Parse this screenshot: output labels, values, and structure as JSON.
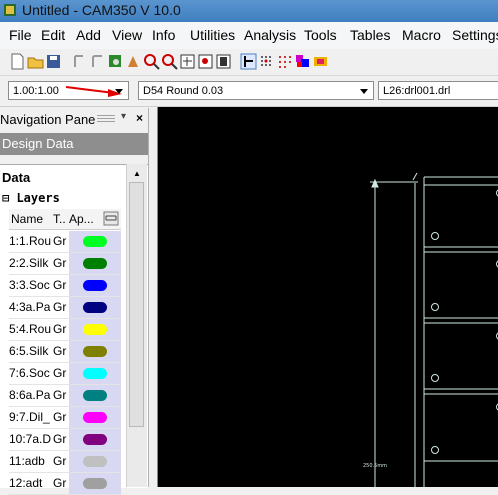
{
  "window": {
    "title": "Untitled - CAM350 V 10.0"
  },
  "menu": {
    "items": [
      {
        "label": "File"
      },
      {
        "label": "Edit"
      },
      {
        "label": "Add"
      },
      {
        "label": "View"
      },
      {
        "label": "Info"
      },
      {
        "label": "Utilities"
      },
      {
        "label": "Analysis"
      },
      {
        "label": "Tools"
      },
      {
        "label": "Tables"
      },
      {
        "label": "Macro"
      },
      {
        "label": "Settings"
      }
    ]
  },
  "toolbar2": {
    "zoom_value": "1.00:1.00",
    "dcode_value": "D54  Round 0.03",
    "layer_value": "L26:drl001.drl"
  },
  "nav_pane": {
    "title": "Navigation Pane",
    "close": "×",
    "design_data": "Design Data",
    "data_label": "Data",
    "layers_label": "⊟ Layers",
    "columns": {
      "name": "Name",
      "type": "T..",
      "appearance": "Ap..."
    },
    "layers": [
      {
        "name": "1:1.Rou",
        "type": "Gr",
        "color": "#00ff22"
      },
      {
        "name": "2:2.Silk",
        "type": "Gr",
        "color": "#008000"
      },
      {
        "name": "3:3.Soc",
        "type": "Gr",
        "color": "#0000ff"
      },
      {
        "name": "4:3a.Pa",
        "type": "Gr",
        "color": "#000080"
      },
      {
        "name": "5:4.Rou",
        "type": "Gr",
        "color": "#ffff00"
      },
      {
        "name": "6:5.Silk",
        "type": "Gr",
        "color": "#808000"
      },
      {
        "name": "7:6.Soc",
        "type": "Gr",
        "color": "#00ffff"
      },
      {
        "name": "8:6a.Pa",
        "type": "Gr",
        "color": "#008080"
      },
      {
        "name": "9:7.Dil_",
        "type": "Gr",
        "color": "#ff00ff"
      },
      {
        "name": "10:7a.D",
        "type": "Gr",
        "color": "#800080"
      },
      {
        "name": "11:adb",
        "type": "Gr",
        "color": "#c0c0c0"
      },
      {
        "name": "12:adt",
        "type": "Gr",
        "color": "#a0a0a0"
      }
    ]
  },
  "canvas": {
    "dimension_label": "250.5mm"
  }
}
